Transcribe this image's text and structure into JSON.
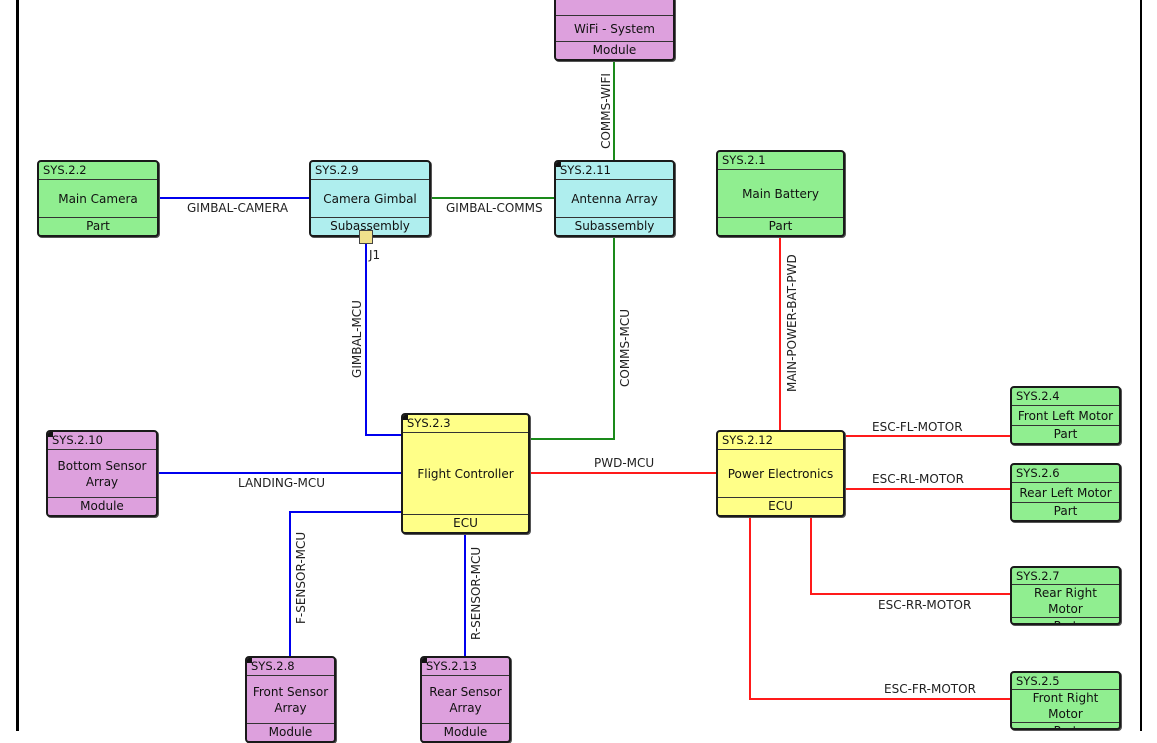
{
  "diagram": {
    "blocks": {
      "wifi": {
        "id": "",
        "name": "WiFi - System",
        "type": "Module"
      },
      "main_camera": {
        "id": "SYS.2.2",
        "name": "Main Camera",
        "type": "Part"
      },
      "camera_gimbal": {
        "id": "SYS.2.9",
        "name": "Camera Gimbal",
        "type": "Subassembly"
      },
      "antenna_array": {
        "id": "SYS.2.11",
        "name": "Antenna Array",
        "type": "Subassembly"
      },
      "main_battery": {
        "id": "SYS.2.1",
        "name": "Main Battery",
        "type": "Part"
      },
      "bottom_sensor": {
        "id": "SYS.2.10",
        "name": "Bottom Sensor Array",
        "type": "Module"
      },
      "flight_controller": {
        "id": "SYS.2.3",
        "name": "Flight Controller",
        "type": "ECU"
      },
      "power_electronics": {
        "id": "SYS.2.12",
        "name": "Power Electronics",
        "type": "ECU"
      },
      "front_left_motor": {
        "id": "SYS.2.4",
        "name": "Front Left Motor",
        "type": "Part"
      },
      "rear_left_motor": {
        "id": "SYS.2.6",
        "name": "Rear Left Motor",
        "type": "Part"
      },
      "rear_right_motor": {
        "id": "SYS.2.7",
        "name": "Rear Right Motor",
        "type": "Part"
      },
      "front_right_motor": {
        "id": "SYS.2.5",
        "name": "Front Right Motor",
        "type": "Part"
      },
      "front_sensor": {
        "id": "SYS.2.8",
        "name": "Front Sensor Array",
        "type": "Module"
      },
      "rear_sensor": {
        "id": "SYS.2.13",
        "name": "Rear Sensor Array",
        "type": "Module"
      }
    },
    "port": {
      "label": "J1"
    },
    "connections": {
      "comms_wifi": "COMMS-WIFI",
      "gimbal_camera": "GIMBAL-CAMERA",
      "gimbal_comms": "GIMBAL-COMMS",
      "gimbal_mcu": "GIMBAL-MCU",
      "comms_mcu": "COMMS-MCU",
      "main_power_bat_pwd": "MAIN-POWER-BAT-PWD",
      "landing_mcu": "LANDING-MCU",
      "pwd_mcu": "PWD-MCU",
      "esc_fl_motor": "ESC-FL-MOTOR",
      "esc_rl_motor": "ESC-RL-MOTOR",
      "esc_rr_motor": "ESC-RR-MOTOR",
      "esc_fr_motor": "ESC-FR-MOTOR",
      "f_sensor_mcu": "F-SENSOR-MCU",
      "r_sensor_mcu": "R-SENSOR-MCU"
    },
    "colors": {
      "data_wire": "#0000ee",
      "comms_wire": "#1a8a1a",
      "power_wire": "#ff1a1a",
      "part": "#90ee90",
      "subassembly": "#afeeee",
      "module": "#dda0dd",
      "ecu": "#ffff88"
    }
  }
}
